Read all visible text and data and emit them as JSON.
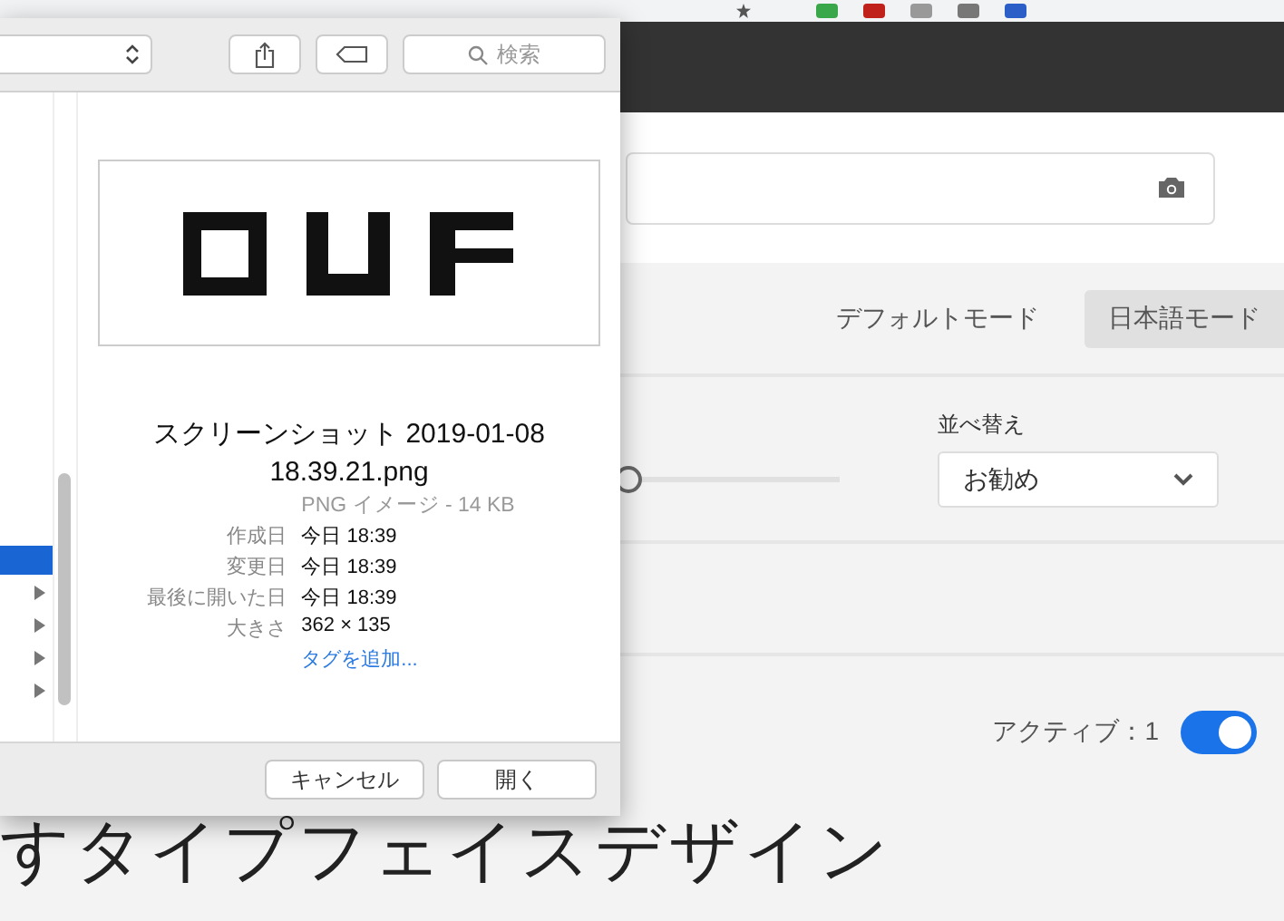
{
  "page": {
    "modes": [
      {
        "label": "デフォルトモード",
        "selected": false
      },
      {
        "label": "日本語モード",
        "selected": true
      }
    ],
    "slider": {
      "level": 0.47
    },
    "sort": {
      "label": "並べ替え",
      "value": "お勧め"
    },
    "active": {
      "label": "アクティブ：1",
      "on": true
    },
    "heading": "すタイプフェイスデザイン"
  },
  "dialog": {
    "search": {
      "placeholder": "検索"
    },
    "sidebar": {
      "rows": [
        {
          "selected": true,
          "expandable": false
        },
        {
          "selected": false,
          "expandable": true
        },
        {
          "selected": false,
          "expandable": true
        },
        {
          "selected": false,
          "expandable": true
        },
        {
          "selected": false,
          "expandable": true
        }
      ]
    },
    "preview": {
      "kind": "picture",
      "filename": "スクリーンショット 2019-01-08 18.39.21.png",
      "type_size": "PNG イメージ - 14 KB",
      "info": [
        {
          "label": "作成日",
          "value": "今日 18:39"
        },
        {
          "label": "変更日",
          "value": "今日 18:39"
        },
        {
          "label": "最後に開いた日",
          "value": "今日 18:39"
        },
        {
          "label": "大きさ",
          "value": "362 × 135"
        }
      ],
      "add_tag": "タグを追加..."
    },
    "buttons": [
      "キャンセル",
      "開く"
    ]
  }
}
